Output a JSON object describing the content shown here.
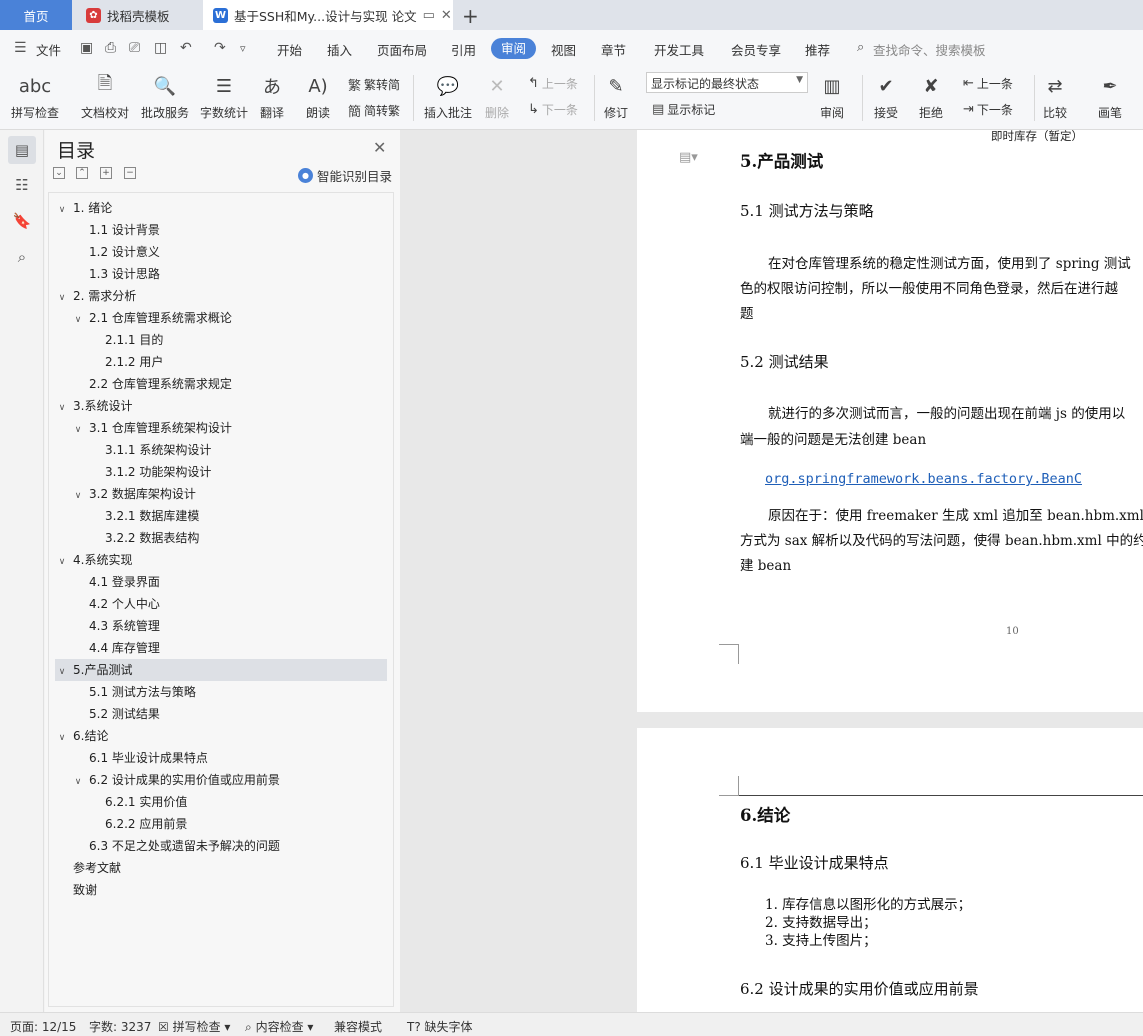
{
  "tabs": {
    "home": "首页",
    "template": "找稻壳模板",
    "doc": "基于SSH和My...设计与实现 论文",
    "add": "+"
  },
  "menu": {
    "file": "文件",
    "items": [
      "开始",
      "插入",
      "页面布局",
      "引用",
      "审阅",
      "视图",
      "章节",
      "开发工具",
      "会员专享",
      "推荐"
    ],
    "active": "审阅",
    "search": "查找命令、搜索模板"
  },
  "ribbon": {
    "spell": "拼写检查",
    "doc_check": "文档校对",
    "review_service": "批改服务",
    "word_count": "字数统计",
    "translate": "翻译",
    "read_aloud": "朗读",
    "trad": "繁转简",
    "simp": "简转繁",
    "insert_comment": "插入批注",
    "delete": "删除",
    "prev1": "上一条",
    "next1": "下一条",
    "track": "修订",
    "markup_state": "显示标记的最终状态",
    "show_markup": "显示标记",
    "review": "审阅",
    "accept": "接受",
    "reject": "拒绝",
    "prev2": "上一条",
    "next2": "下一条",
    "compare": "比较",
    "pen": "画笔"
  },
  "toc": {
    "title": "目录",
    "smart": "智能识别目录",
    "items": [
      {
        "label": "1. 绪论",
        "level": 1,
        "arrow": true
      },
      {
        "label": "1.1  设计背景",
        "level": 2,
        "arrow": false
      },
      {
        "label": "1.2  设计意义",
        "level": 2,
        "arrow": false
      },
      {
        "label": "1.3  设计思路",
        "level": 2,
        "arrow": false
      },
      {
        "label": "2. 需求分析",
        "level": 1,
        "arrow": true
      },
      {
        "label": "2.1  仓库管理系统需求概论",
        "level": 2,
        "arrow": true
      },
      {
        "label": "2.1.1  目的",
        "level": 3,
        "arrow": false
      },
      {
        "label": "2.1.2  用户",
        "level": 3,
        "arrow": false
      },
      {
        "label": "2.2  仓库管理系统需求规定",
        "level": 2,
        "arrow": false
      },
      {
        "label": "3.系统设计",
        "level": 1,
        "arrow": true
      },
      {
        "label": "3.1  仓库管理系统架构设计",
        "level": 2,
        "arrow": true
      },
      {
        "label": "3.1.1  系统架构设计",
        "level": 3,
        "arrow": false
      },
      {
        "label": "3.1.2  功能架构设计",
        "level": 3,
        "arrow": false
      },
      {
        "label": "3.2  数据库架构设计",
        "level": 2,
        "arrow": true
      },
      {
        "label": "3.2.1  数据库建模",
        "level": 3,
        "arrow": false
      },
      {
        "label": "3.2.2  数据表结构",
        "level": 3,
        "arrow": false
      },
      {
        "label": "4.系统实现",
        "level": 1,
        "arrow": true
      },
      {
        "label": "4.1  登录界面",
        "level": 2,
        "arrow": false
      },
      {
        "label": "4.2 个人中心",
        "level": 2,
        "arrow": false
      },
      {
        "label": "4.3  系统管理",
        "level": 2,
        "arrow": false
      },
      {
        "label": "4.4  库存管理",
        "level": 2,
        "arrow": false
      },
      {
        "label": "5.产品测试",
        "level": 1,
        "arrow": true,
        "selected": true
      },
      {
        "label": "5.1 测试方法与策略",
        "level": 2,
        "arrow": false
      },
      {
        "label": "5.2 测试结果",
        "level": 2,
        "arrow": false
      },
      {
        "label": "6.结论",
        "level": 1,
        "arrow": true
      },
      {
        "label": "6.1  毕业设计成果特点",
        "level": 2,
        "arrow": false
      },
      {
        "label": "6.2  设计成果的实用价值或应用前景",
        "level": 2,
        "arrow": true
      },
      {
        "label": "6.2.1 实用价值",
        "level": 3,
        "arrow": false
      },
      {
        "label": "6.2.2 应用前景",
        "level": 3,
        "arrow": false
      },
      {
        "label": "6.3  不足之处或遗留未予解决的问题",
        "level": 2,
        "arrow": false
      },
      {
        "label": "参考文献",
        "level": 1,
        "arrow": false
      },
      {
        "label": "致谢",
        "level": 1,
        "arrow": false
      }
    ]
  },
  "doc": {
    "header_text": "即时库存（暂定）",
    "h_5": "5.产品测试",
    "h_51": "5.1 测试方法与策略",
    "p_51_1": "在对仓库管理系统的稳定性测试方面，使用到了 spring 测试",
    "p_51_2": "色的权限访问控制，所以一般使用不同角色登录，然后在进行越",
    "p_51_3": "题",
    "h_52": "5.2 测试结果",
    "p_52_1": "就进行的多次测试而言，一般的问题出现在前端 js 的使用以",
    "p_52_2": "端一般的问题是无法创建 bean",
    "code": "org.springframework.beans.factory.BeanC",
    "p_52_3": "原因在于：使用 freemaker 生成 xml 追加至 bean.hbm.xml 中，",
    "p_52_4": "方式为 sax 解析以及代码的写法问题，使得 bean.hbm.xml 中的约",
    "p_52_5": "建 bean",
    "page_number": "10",
    "h_6": "6.结论",
    "h_61": "6.1  毕业设计成果特点",
    "list": [
      "1.   库存信息以图形化的方式展示；",
      "2.   支持数据导出；",
      "3.   支持上传图片；"
    ],
    "h_62": "6.2  设计成果的实用价值或应用前景"
  },
  "status": {
    "page": "页面: 12/15",
    "words": "字数: 3237",
    "spell": "拼写检查",
    "content": "内容检查",
    "compat": "兼容模式",
    "missing_font": "缺失字体"
  },
  "colors": {
    "accent": "#4a82d8",
    "toc_selected": "#dde0e5",
    "link": "#1f5fb8"
  }
}
